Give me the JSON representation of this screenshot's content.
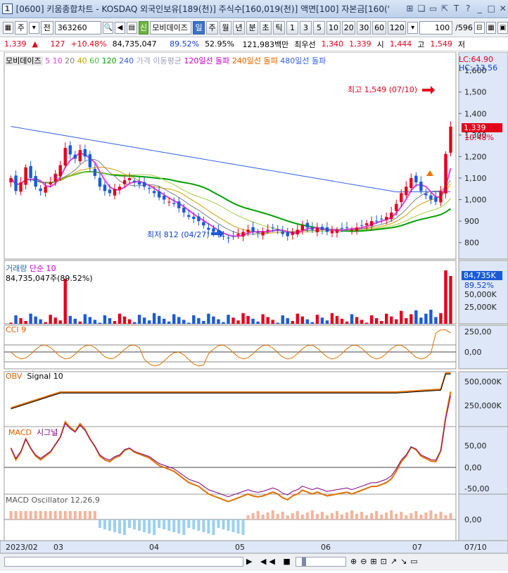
{
  "window": {
    "number": "1",
    "title": "[0600] 키움종합차트 - KOSDAQ 외국인보유[189(천)] 주식수[160,019(천)] 액면[100] 자본금[160('",
    "buttons": [
      "⊞",
      "❏",
      "▭",
      "⇱",
      "T",
      "?",
      "_",
      "□",
      "✕"
    ]
  },
  "toolbar": {
    "period_select": "주",
    "type_select": "전",
    "stock_code": "363260",
    "stock_name": "모비데이즈",
    "period_buttons": [
      "일",
      "주",
      "월",
      "년",
      "분",
      "초",
      "틱"
    ],
    "active_period": "일",
    "interval_buttons": [
      "1",
      "3",
      "5",
      "10",
      "20",
      "30",
      "60",
      "120"
    ],
    "count_value": "100",
    "count_total": "/596"
  },
  "quote": {
    "price": "1,339",
    "arrow": "▲",
    "change": "127",
    "change_pct": "+10.48%",
    "volume": "84,735,047",
    "vol_ratio": "89.52%",
    "turnover": "52.95%",
    "amount": "121,983백만",
    "bid_label": "최우선",
    "bid": "1,340",
    "ask": "1,339",
    "open_label": "시",
    "open": "1,444",
    "high_label": "고",
    "high": "1,549",
    "low_label": "저"
  },
  "price_panel": {
    "legend_name": "모비데이즈",
    "legend_ma": [
      "5",
      "10",
      "20",
      "40",
      "60",
      "120",
      "240"
    ],
    "legend_ma_colors": [
      "#e040e0",
      "#e040e0",
      "#808080",
      "#f0a000",
      "#40c040",
      "#00a000",
      "#3060e0"
    ],
    "legend_items": [
      "가격 이동평균",
      "120일선 돌파",
      "240일선 돌파",
      "480일선 돌파"
    ],
    "legend_colors": [
      "#a0a0c0",
      "#c000c0",
      "#e06000",
      "#3060e0"
    ],
    "lc": "LC:64.90",
    "hc": "HC:-13.56",
    "y_ticks": [
      "1,600",
      "1,500",
      "1,400",
      "1,300",
      "1,200",
      "1,100",
      "1,000",
      "900",
      "800"
    ],
    "current_price": "1,339",
    "current_pct": "10.48%",
    "high_note": "최고 1,549 (07/10)",
    "low_note": "최저 812 (04/27)"
  },
  "volume_panel": {
    "title": "거래량",
    "ma_label": "단순 10",
    "info": "84,735,047주(89.52%)",
    "current": "84,735K",
    "current_pct": "89.52%",
    "y_ticks": [
      "50,000K",
      "25,000K"
    ]
  },
  "cci_panel": {
    "title": "CCI 9",
    "y_ticks": [
      "250,00",
      "0,00"
    ]
  },
  "obv_panel": {
    "title": "OBV",
    "signal": "Signal 10",
    "y_ticks": [
      "500,000K",
      "250,000K"
    ]
  },
  "macd_panel": {
    "title": "MACD",
    "signal": "시그널",
    "y_ticks": [
      "50,00",
      "0,00",
      "-50,00"
    ]
  },
  "osc_panel": {
    "title": "MACD Oscillator 12,26,9",
    "y_ticks": [
      "0,00"
    ]
  },
  "x_axis": {
    "labels": [
      "2023/02",
      "03",
      "04",
      "05",
      "06",
      "07",
      "07/10"
    ]
  },
  "colors": {
    "up": "#e3001b",
    "down": "#1a5ad7",
    "accent": "#3d74c7",
    "current_box": "#e3001b"
  },
  "chart_data": {
    "type": "candlestick",
    "title": "모비데이즈",
    "x": [
      "2023/02",
      "03",
      "04",
      "05",
      "06",
      "07"
    ],
    "price_high": 1549,
    "price_high_date": "07/10",
    "price_low": 812,
    "price_low_date": "04/27",
    "last_close": 1339,
    "last_volume": "84,735K",
    "ylim": [
      750,
      1620
    ],
    "series": [
      {
        "name": "종가",
        "values": [
          1100,
          1040,
          1080,
          1150,
          1100,
          1060,
          1040,
          1060,
          1080,
          1120,
          1160,
          1240,
          1210,
          1190,
          1230,
          1200,
          1150,
          1110,
          1060,
          1040,
          1030,
          1050,
          1060,
          1090,
          1100,
          1080,
          1070,
          1060,
          1050,
          1030,
          1010,
          1000,
          990,
          980,
          960,
          940,
          920,
          910,
          900,
          880,
          860,
          850,
          840,
          830,
          820,
          830,
          840,
          850,
          860,
          850,
          845,
          850,
          860,
          870,
          860,
          840,
          830,
          850,
          860,
          880,
          870,
          860,
          870,
          860,
          850,
          855,
          860,
          865,
          870,
          860,
          870,
          880,
          890,
          900,
          900,
          910,
          920,
          940,
          980,
          1030,
          1060,
          1100,
          1080,
          1040,
          1020,
          1000,
          990,
          1040,
          1212,
          1339
        ]
      }
    ],
    "ma_colors": [
      "#e040e0",
      "#808080",
      "#40c040",
      "#00a000",
      "#3060e0"
    ]
  }
}
